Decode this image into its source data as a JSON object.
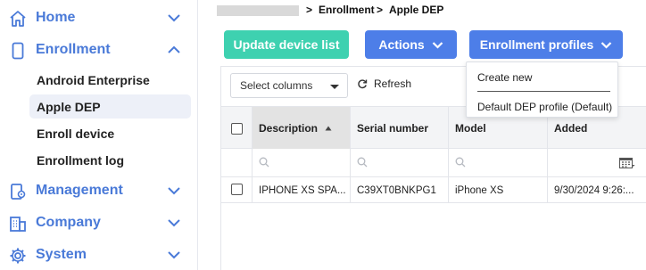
{
  "sidebar": {
    "sections": {
      "home": "Home",
      "enrollment": "Enrollment",
      "management": "Management",
      "company": "Company",
      "system": "System"
    },
    "enrollment_items": [
      "Android Enterprise",
      "Apple DEP",
      "Enroll device",
      "Enrollment log"
    ],
    "active_item": "Apple DEP"
  },
  "breadcrumb": {
    "separator": ">",
    "items": [
      "Enrollment",
      "Apple DEP"
    ]
  },
  "toolbar": {
    "update_label": "Update device list",
    "actions_label": "Actions",
    "profiles_label": "Enrollment profiles",
    "update_color": "#3ed1b0",
    "primary_color": "#4d7ee8"
  },
  "controls": {
    "select_columns": "Select columns",
    "refresh": "Refresh"
  },
  "profiles_menu": {
    "items": [
      "Create new",
      "Default DEP profile (Default)"
    ]
  },
  "table": {
    "columns": [
      "Description",
      "Serial number",
      "Model",
      "Added"
    ],
    "sorted_column": "Description",
    "sort_direction": "ascending",
    "rows": [
      [
        "IPHONE XS SPA...",
        "C39XT0BNKPG1",
        "iPhone XS",
        "9/30/2024 9:26:..."
      ]
    ]
  },
  "icons": [
    "home-icon",
    "phone-icon",
    "management-icon",
    "company-icon",
    "gear-icon",
    "refresh-icon",
    "search-icon",
    "calendar-icon",
    "chevron-down-icon",
    "chevron-up-icon",
    "sort-asc-icon"
  ],
  "colors": {
    "accent": "#4a7ad8",
    "active_bg": "#edf0f8"
  }
}
